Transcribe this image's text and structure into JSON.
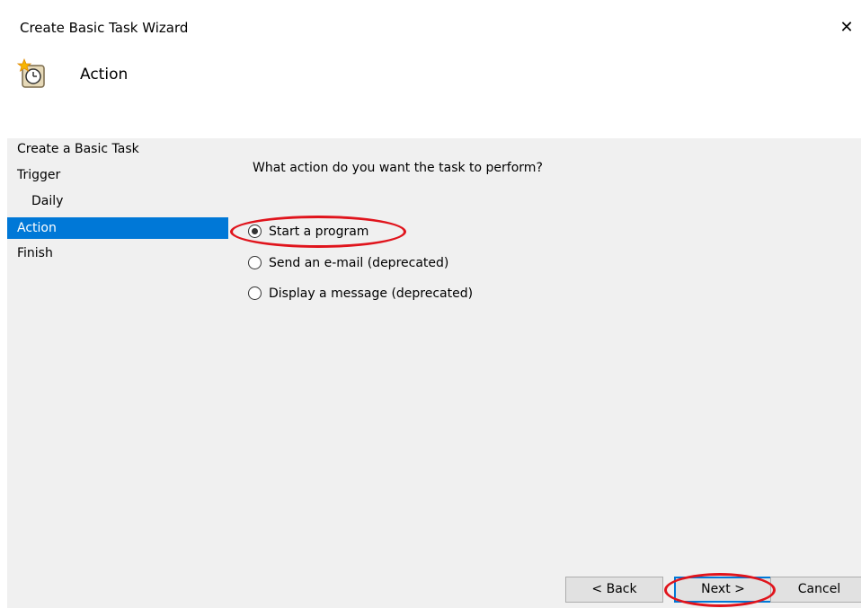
{
  "window": {
    "title": "Create Basic Task Wizard",
    "close_label": "✕"
  },
  "header": {
    "icon": "task-scheduler-clock-icon",
    "title": "Action"
  },
  "sidebar": {
    "items": [
      {
        "label": "Create a Basic Task",
        "selected": false
      },
      {
        "label": "Trigger",
        "selected": false
      },
      {
        "label": "Daily",
        "selected": false
      },
      {
        "label": "Action",
        "selected": true
      },
      {
        "label": "Finish",
        "selected": false
      }
    ]
  },
  "main": {
    "question": "What action do you want the task to perform?",
    "options": [
      {
        "label": "Start a program",
        "checked": true
      },
      {
        "label": "Send an e-mail (deprecated)",
        "checked": false
      },
      {
        "label": "Display a message (deprecated)",
        "checked": false
      }
    ]
  },
  "buttons": {
    "back": "< Back",
    "next": "Next >",
    "cancel": "Cancel"
  },
  "colors": {
    "selection": "#0078d7",
    "annotation": "#e0141c",
    "panel": "#f0f0f0"
  }
}
